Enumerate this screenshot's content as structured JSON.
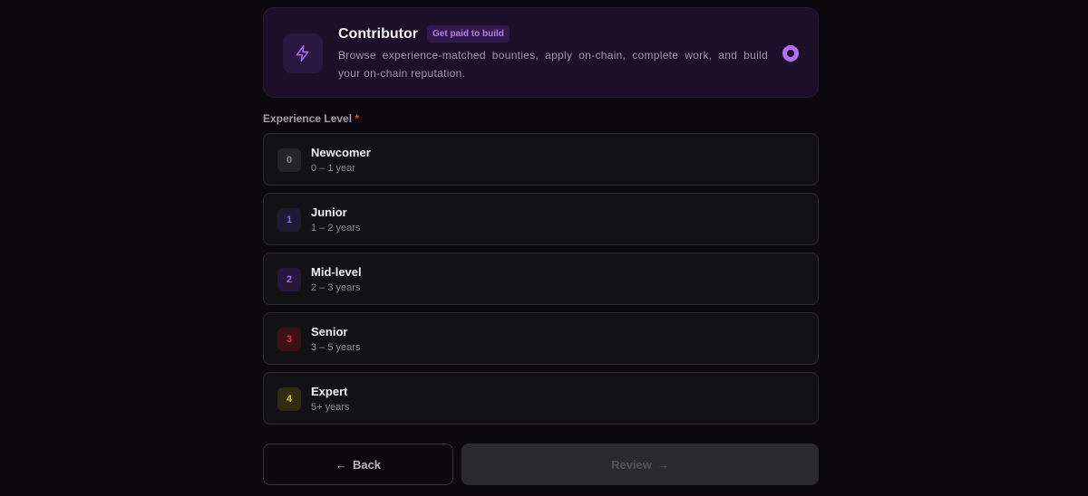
{
  "role": {
    "title": "Contributor",
    "badge": "Get paid to build",
    "description": "Browse experience-matched bounties, apply on-chain, complete work, and build your on-chain reputation.",
    "icon": "lightning-icon",
    "selected": true,
    "accent_color": "#b26ef5"
  },
  "experience": {
    "label": "Experience Level",
    "required_mark": "*",
    "levels": [
      {
        "num": "0",
        "title": "Newcomer",
        "sub": "0 – 1 year",
        "bg": "#252427",
        "fg": "#8a868f"
      },
      {
        "num": "1",
        "title": "Junior",
        "sub": "1 – 2 years",
        "bg": "#1c1b33",
        "fg": "#6f74e8"
      },
      {
        "num": "2",
        "title": "Mid-level",
        "sub": "2 – 3 years",
        "bg": "#27173a",
        "fg": "#a866f0"
      },
      {
        "num": "3",
        "title": "Senior",
        "sub": "3 – 5 years",
        "bg": "#3a1216",
        "fg": "#e2303e"
      },
      {
        "num": "4",
        "title": "Expert",
        "sub": "5+ years",
        "bg": "#2f2c12",
        "fg": "#e6c82c"
      }
    ]
  },
  "buttons": {
    "back_arrow": "←",
    "back": "Back",
    "review": "Review",
    "review_arrow": "→"
  }
}
